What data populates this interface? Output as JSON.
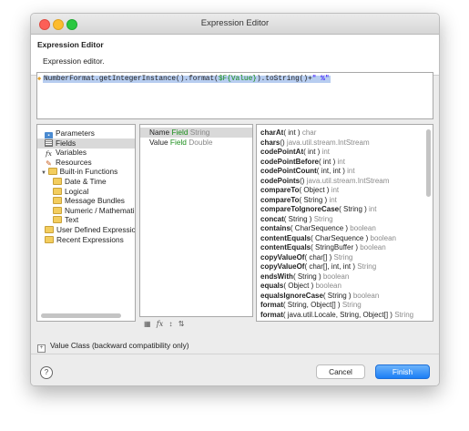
{
  "window": {
    "title": "Expression Editor"
  },
  "header": {
    "title": "Expression Editor",
    "description": "Expression editor."
  },
  "editor": {
    "prefix": "NumberFormat.getIntegerInstance().format(",
    "field": "$F{Value}",
    "middle": ").toString()+",
    "string": "\" %\""
  },
  "tree": {
    "items": [
      {
        "label": "Parameters",
        "icon": "parameters-icon"
      },
      {
        "label": "Fields",
        "icon": "fields-icon",
        "selected": true
      },
      {
        "label": "Variables",
        "icon": "function-icon"
      },
      {
        "label": "Resources",
        "icon": "resources-icon"
      },
      {
        "label": "Built-in Functions",
        "icon": "folder-icon",
        "expanded": true
      },
      {
        "label": "Date & Time",
        "icon": "folder-icon"
      },
      {
        "label": "Logical",
        "icon": "folder-icon"
      },
      {
        "label": "Message Bundles",
        "icon": "folder-icon"
      },
      {
        "label": "Numeric / Mathemati",
        "icon": "folder-icon"
      },
      {
        "label": "Text",
        "icon": "folder-icon"
      },
      {
        "label": "User Defined Expressio",
        "icon": "folder-icon"
      },
      {
        "label": "Recent Expressions",
        "icon": "folder-icon"
      }
    ]
  },
  "fields": {
    "items": [
      {
        "name": "Name",
        "kind": "Field",
        "type": "String"
      },
      {
        "name": "Value",
        "kind": "Field",
        "type": "Double"
      }
    ]
  },
  "methods": {
    "items": [
      {
        "name": "charAt",
        "args": "( int )",
        "ret": "char"
      },
      {
        "name": "chars",
        "args": "()",
        "ret": "java.util.stream.IntStream"
      },
      {
        "name": "codePointAt",
        "args": "( int )",
        "ret": "int"
      },
      {
        "name": "codePointBefore",
        "args": "( int )",
        "ret": "int"
      },
      {
        "name": "codePointCount",
        "args": "( int, int )",
        "ret": "int"
      },
      {
        "name": "codePoints",
        "args": "()",
        "ret": "java.util.stream.IntStream"
      },
      {
        "name": "compareTo",
        "args": "( Object )",
        "ret": "int"
      },
      {
        "name": "compareTo",
        "args": "( String )",
        "ret": "int"
      },
      {
        "name": "compareToIgnoreCase",
        "args": "( String )",
        "ret": "int"
      },
      {
        "name": "concat",
        "args": "( String )",
        "ret": "String"
      },
      {
        "name": "contains",
        "args": "( CharSequence )",
        "ret": "boolean"
      },
      {
        "name": "contentEquals",
        "args": "( CharSequence )",
        "ret": "boolean"
      },
      {
        "name": "contentEquals",
        "args": "( StringBuffer )",
        "ret": "boolean"
      },
      {
        "name": "copyValueOf",
        "args": "( char[] )",
        "ret": "String"
      },
      {
        "name": "copyValueOf",
        "args": "( char[], int, int )",
        "ret": "String"
      },
      {
        "name": "endsWith",
        "args": "( String )",
        "ret": "boolean"
      },
      {
        "name": "equals",
        "args": "( Object )",
        "ret": "boolean"
      },
      {
        "name": "equalsIgnoreCase",
        "args": "( String )",
        "ret": "boolean"
      },
      {
        "name": "format",
        "args": "( String, Object[] )",
        "ret": "String"
      },
      {
        "name": "format",
        "args": "( java.util.Locale, String, Object[] )",
        "ret": "String"
      }
    ]
  },
  "toolbar": {
    "icons": [
      "fields-toolbar-icon",
      "function-toolbar-icon",
      "sort-az-icon",
      "sort-za-icon"
    ]
  },
  "value_class": {
    "label": "Value Class (backward compatibility only)",
    "toggle": "+"
  },
  "buttons": {
    "help": "?",
    "cancel": "Cancel",
    "finish": "Finish"
  },
  "colors": {
    "accent": "#1b7ef6",
    "field_green": "#1b8e1b",
    "return_grey": "#8a8a8a"
  }
}
